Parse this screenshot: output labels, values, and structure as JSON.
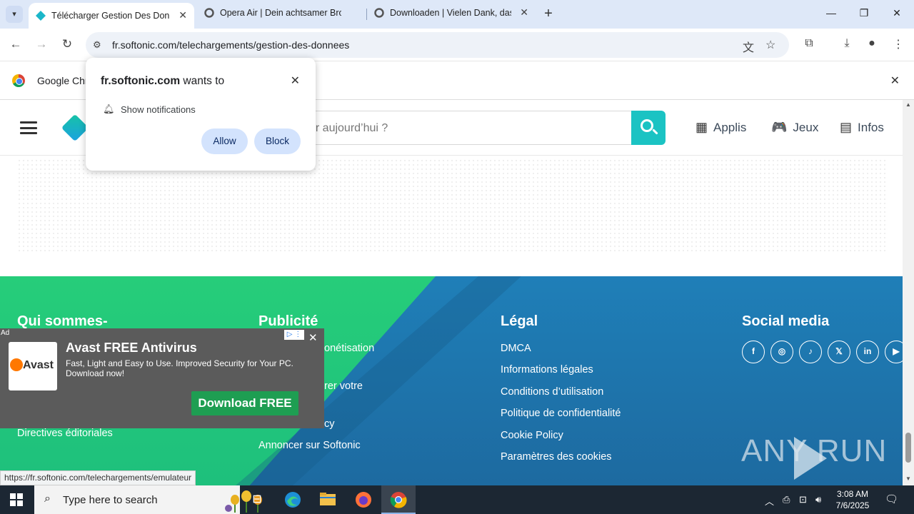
{
  "browser": {
    "tabs": [
      {
        "title": "Télécharger Gestion Des Donné",
        "active": true
      },
      {
        "title": "Opera Air | Dein achtsamer Bro",
        "active": false
      },
      {
        "title": "Downloaden | Vielen Dank, das",
        "active": false
      }
    ],
    "url": "fr.softonic.com/telechargements/gestion-des-donnees"
  },
  "infobar": {
    "text": "Google Chro"
  },
  "permission": {
    "site": "fr.softonic.com",
    "wants_to": "wants to",
    "option": "Show notifications",
    "allow": "Allow",
    "block": "Block"
  },
  "site": {
    "search_placeholder": "ver aujourd’hui ?",
    "nav": [
      "Applis",
      "Jeux",
      "Infos"
    ]
  },
  "footer": {
    "col1": {
      "heading": "Qui sommes-",
      "links": [
        "Directives éditoriales"
      ]
    },
    "col2": {
      "heading": "Publicité",
      "links": [
        "onétisation",
        "rer votre",
        "cy",
        "Annoncer sur Softonic"
      ]
    },
    "col3": {
      "heading": "Légal",
      "links": [
        "DMCA",
        "Informations légales",
        "Conditions d’utilisation",
        "Politique de confidentialité",
        "Cookie Policy",
        "Paramètres des cookies"
      ]
    },
    "col4": {
      "heading": "Social media"
    }
  },
  "ad": {
    "tag": "Ad",
    "logo_word": "Avast",
    "title": "Avast FREE Antivirus",
    "description": "Fast, Light and Easy to Use. Improved Security for Your PC. Download now!",
    "cta": "Download FREE"
  },
  "watermark": "ANY RUN",
  "status_url": "https://fr.softonic.com/telechargements/emulateur",
  "taskbar": {
    "search_placeholder": "Type here to search",
    "time": "3:08 AM",
    "date": "7/6/2025"
  }
}
